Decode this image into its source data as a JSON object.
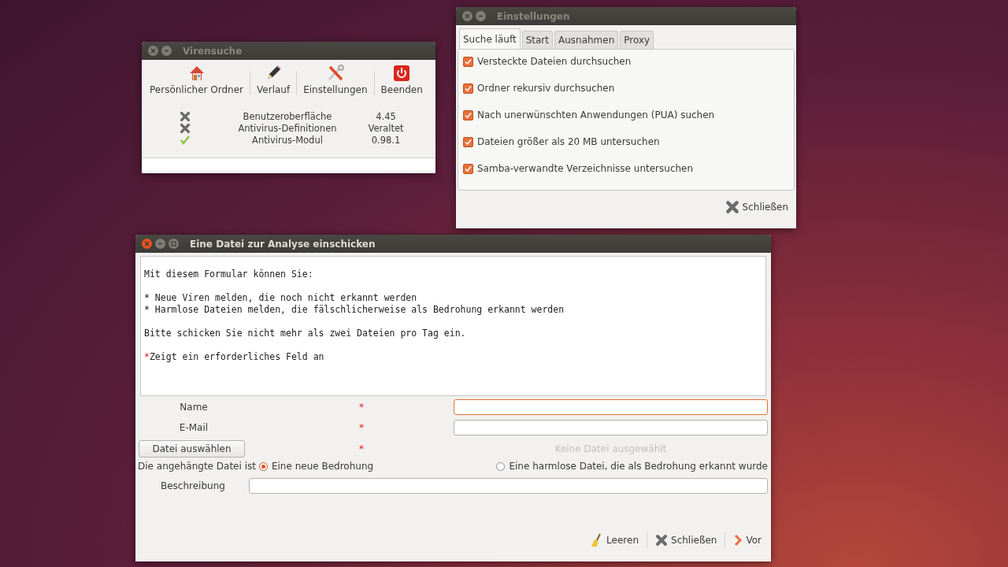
{
  "scan_window": {
    "title": "Virensuche",
    "toolbar": [
      {
        "label": "Persönlicher Ordner",
        "kind": "home"
      },
      {
        "label": "Verlauf",
        "kind": "pencil"
      },
      {
        "label": "Einstellungen",
        "kind": "tools"
      },
      {
        "label": "Beenden",
        "kind": "power"
      }
    ],
    "status": [
      {
        "name": "Benutzeroberfläche",
        "value": "4.45",
        "ok": false
      },
      {
        "name": "Antivirus-Definitionen",
        "value": "Veraltet",
        "ok": false
      },
      {
        "name": "Antivirus-Modul",
        "value": "0.98.1",
        "ok": true
      }
    ]
  },
  "settings_window": {
    "title": "Einstellungen",
    "tabs": [
      {
        "label": "Suche läuft",
        "selected": true
      },
      {
        "label": "Start",
        "selected": false
      },
      {
        "label": "Ausnahmen",
        "selected": false
      },
      {
        "label": "Proxy",
        "selected": false
      }
    ],
    "options": [
      {
        "label": "Versteckte Dateien durchsuchen",
        "checked": true
      },
      {
        "label": "Ordner rekursiv durchsuchen",
        "checked": true
      },
      {
        "label": "Nach unerwünschten Anwendungen (PUA) suchen",
        "checked": true
      },
      {
        "label": "Dateien größer als 20 MB untersuchen",
        "checked": true
      },
      {
        "label": "Samba-verwandte Verzeichnisse untersuchen",
        "checked": true
      }
    ],
    "close_button": "Schließen"
  },
  "submit_window": {
    "title": "Eine Datei zur Analyse einschicken",
    "info_paragraphs": [
      [
        "Mit diesem Formular können Sie:"
      ],
      [
        "* Neue Viren melden, die noch nicht erkannt werden",
        "* Harmlose Dateien melden, die fälschlicherweise als Bedrohung erkannt werden"
      ],
      [
        "Bitte schicken Sie nicht mehr als zwei Dateien pro Tag ein."
      ]
    ],
    "required_note": {
      "mark": "*",
      "text": "Zeigt ein erforderliches Feld an"
    },
    "fields": [
      {
        "label": "Name",
        "required_mark": "*",
        "kind": "input",
        "focused": true
      },
      {
        "label": "E-Mail",
        "required_mark": "*",
        "kind": "input",
        "focused": false
      },
      {
        "label": "Datei auswählen",
        "required_mark": "*",
        "kind": "file",
        "status": "Keine Datei ausgewählt"
      }
    ],
    "attachment": {
      "label": "Die angehängte Datei ist",
      "options": [
        {
          "label": "Eine neue Bedrohung",
          "selected": true
        },
        {
          "label": "Eine harmlose Datei, die als Bedrohung erkannt wurde",
          "selected": false
        }
      ]
    },
    "description": {
      "label": "Beschreibung"
    },
    "buttons": [
      {
        "label": "Leeren",
        "kind": "clear"
      },
      {
        "label": "Schließen",
        "kind": "close"
      },
      {
        "label": "Vor",
        "kind": "next"
      }
    ]
  }
}
